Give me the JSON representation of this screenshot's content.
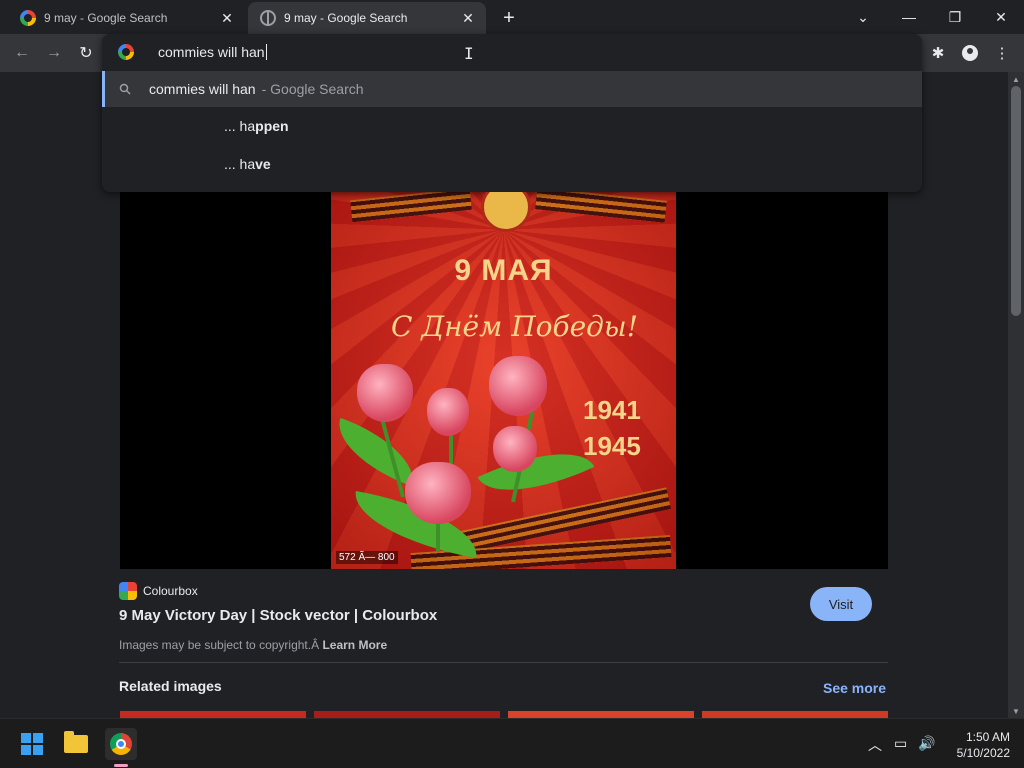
{
  "browser": {
    "tabs": [
      {
        "title": "9 may - Google Search",
        "close": "✕"
      },
      {
        "title": "9 may - Google Search",
        "close": "✕"
      }
    ],
    "new_tab": "+",
    "window_controls": {
      "tab_search": "⌄",
      "minimize": "—",
      "restore": "❐",
      "close": "✕"
    }
  },
  "toolbar": {
    "back": "←",
    "forward": "→",
    "reload": "↻",
    "extensions": "✱",
    "menu": "⋮"
  },
  "omnibox": {
    "value": "commies will han",
    "ibeam": "I",
    "suggestions": [
      {
        "query": "commies will han",
        "hint": "- Google Search"
      },
      {
        "prefix": "... ha",
        "bold": "ppen"
      },
      {
        "prefix": "... ha",
        "bold": "ve"
      }
    ]
  },
  "image_panel": {
    "poster": {
      "title": "9 МАЯ",
      "script": "С Днём Победы!",
      "year1": "1941",
      "year2": "1945"
    },
    "dimensions": "572 Ã— 800",
    "source": "Colourbox",
    "title": "9 May Victory Day | Stock vector | Colourbox",
    "visit_label": "Visit",
    "copyright": "Images may be subject to copyright.Â ",
    "learn_more": "Learn More",
    "related_label": "Related images",
    "see_more": "See more"
  },
  "taskbar": {
    "tray_chevron": "︿",
    "network_icon": "▭",
    "volume_icon": "🔊",
    "time": "1:50 AM",
    "date": "5/10/2022"
  }
}
